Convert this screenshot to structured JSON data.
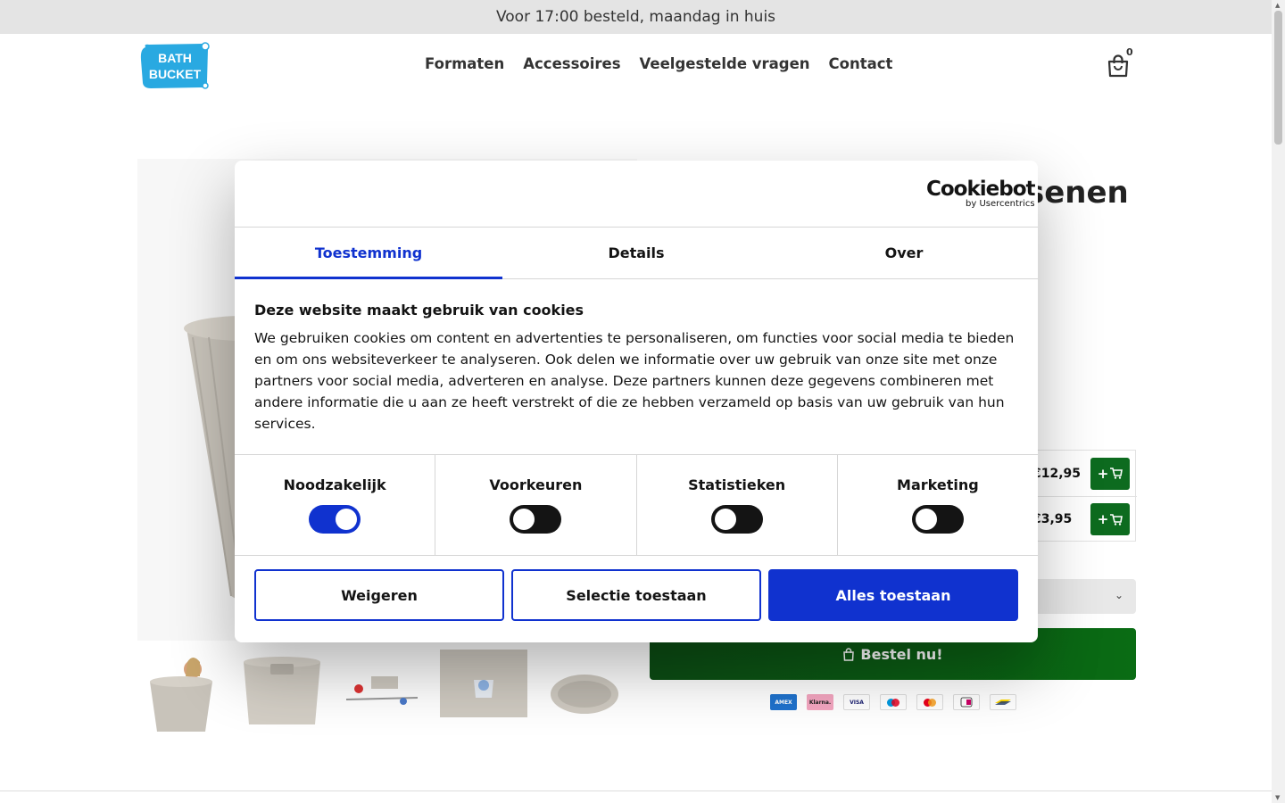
{
  "announcement": "Voor 17:00 besteld, maandag in huis",
  "header": {
    "logo_text_line1": "BATH",
    "logo_text_line2": "BUCKET",
    "nav": [
      "Formaten",
      "Accessoires",
      "Veelgestelde vragen",
      "Contact"
    ],
    "cart_count": "0"
  },
  "product": {
    "title_fragment": "senen",
    "addons": [
      {
        "price": "€12,95",
        "button": "+"
      },
      {
        "price": "€3,95",
        "button": "+"
      }
    ],
    "order_button": "Bestel nu!",
    "payment_methods": [
      "American Express",
      "Klarna",
      "VISA",
      "Maestro",
      "Mastercard",
      "iDEAL",
      "Bancontact"
    ],
    "payment_labels": {
      "amex": "AMEX",
      "klarna": "Klarna.",
      "visa": "VISA"
    }
  },
  "cookie_dialog": {
    "brand": "Cookiebot",
    "brand_sub": "by Usercentrics",
    "tabs": [
      "Toestemming",
      "Details",
      "Over"
    ],
    "active_tab": "Toestemming",
    "heading": "Deze website maakt gebruik van cookies",
    "text": "We gebruiken cookies om content en advertenties te personaliseren, om functies voor social media te bieden en om ons websiteverkeer te analyseren. Ook delen we informatie over uw gebruik van onze site met onze partners voor social media, adverteren en analyse. Deze partners kunnen deze gegevens combineren met andere informatie die u aan ze heeft verstrekt of die ze hebben verzameld op basis van uw gebruik van hun services.",
    "categories": [
      {
        "label": "Noodzakelijk",
        "enabled": true
      },
      {
        "label": "Voorkeuren",
        "enabled": false
      },
      {
        "label": "Statistieken",
        "enabled": false
      },
      {
        "label": "Marketing",
        "enabled": false
      }
    ],
    "buttons": {
      "decline": "Weigeren",
      "allow_selection": "Selectie toestaan",
      "allow_all": "Alles toestaan"
    }
  },
  "colors": {
    "accent": "#1032cf",
    "order_green": "#0a6c14",
    "logo_blue": "#29a9e1"
  }
}
